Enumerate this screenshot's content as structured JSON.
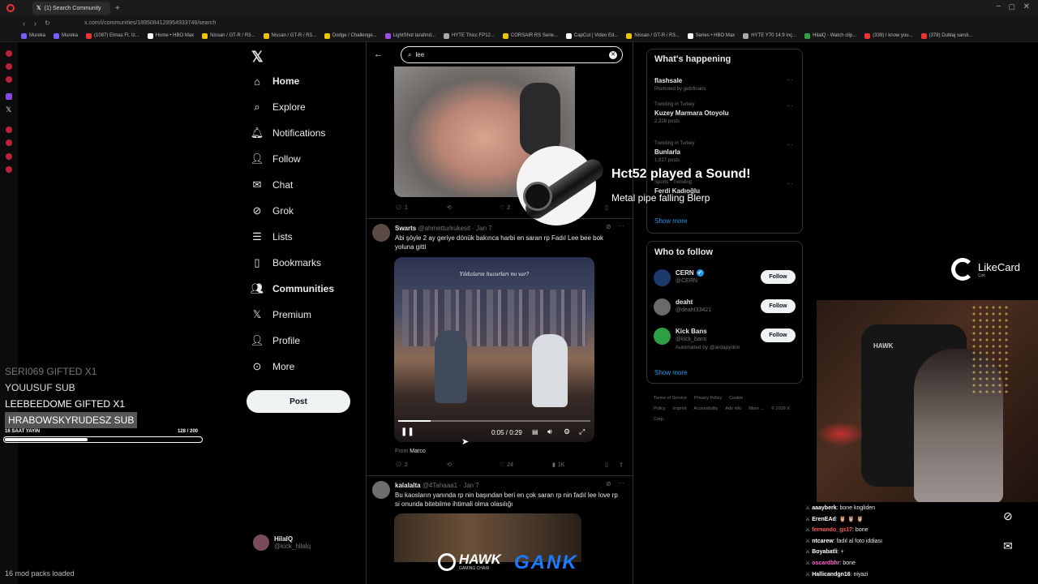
{
  "browser": {
    "tab_title": "(1) Search Community",
    "url": "x.com/i/communities/1895084128954933746/search",
    "bookmarks": [
      "Mureka",
      "Mureka",
      "(1087) Elmas Ft. İz...",
      "Home • HBO Max",
      "Nissan / GT-R / R3...",
      "Nissan / GT-R / R3...",
      "Dodge / Challenge...",
      "LightShot tarafınd...",
      "HYTE Thicc FP12...",
      "CORSAIR RS Serie...",
      "CapCut | Video Ed...",
      "Nissan / GT-R / R3...",
      "Series • HBO Max",
      "HYTE Y70 14.9 inç...",
      "HilalQ - Watch clip...",
      "(339) I know you...",
      "(378) Dublaj sandı..."
    ]
  },
  "nav": {
    "items": [
      {
        "label": "Home",
        "icon": "home-icon",
        "bold": true
      },
      {
        "label": "Explore",
        "icon": "search-icon"
      },
      {
        "label": "Notifications",
        "icon": "bell-icon"
      },
      {
        "label": "Follow",
        "icon": "add-user-icon"
      },
      {
        "label": "Chat",
        "icon": "mail-icon"
      },
      {
        "label": "Grok",
        "icon": "grok-icon"
      },
      {
        "label": "Lists",
        "icon": "list-icon"
      },
      {
        "label": "Bookmarks",
        "icon": "bookmark-icon"
      },
      {
        "label": "Communities",
        "icon": "communities-icon",
        "bold": true
      },
      {
        "label": "Premium",
        "icon": "x-icon"
      },
      {
        "label": "Profile",
        "icon": "person-icon"
      },
      {
        "label": "More",
        "icon": "more-circle-icon"
      }
    ],
    "post_label": "Post",
    "profile_name": "HilalQ",
    "profile_handle": "@kick_hilalq"
  },
  "search": {
    "query": "lee"
  },
  "tweets": [
    {
      "top_actions": {
        "replies": "1",
        "retweets": "",
        "likes": "2"
      }
    },
    {
      "name": "Swarts",
      "handle_time": "@ahmetturkukesit · Jan 7",
      "text": "Abi şöyle 2 ay geriye dönük bakınca harbi en saran rp Fadıl Lee bee bok yoluna gitti",
      "video_caption": "Yıldızların huzurları mı var?",
      "video_time": "0:05 / 0:29",
      "video_progress": 0.17,
      "from_label": "From",
      "from_name": "Marco",
      "replies": "2",
      "retweets": "",
      "likes": "24",
      "views": "1K"
    },
    {
      "name": "kalalalta",
      "handle_time": "@4Tahaaa1 · Jan 7",
      "text": "Bu kaosların yanında rp nin başından beri en çok saran rp nin fadıl lee love rp si onunda bitebilme ihtimali olma olasılığı"
    }
  ],
  "whats_happening": {
    "title": "What's happening",
    "trends": [
      {
        "context": "",
        "name": "flashsale",
        "meta": "Promoted by getirfinans"
      },
      {
        "context": "Trending in Turkey",
        "name": "Kuzey Marmara Otoyolu",
        "meta": "2,328 posts"
      },
      {
        "context": "Trending in Turkey",
        "name": "Bunlarla",
        "meta": "1,917 posts"
      },
      {
        "context": "Sports · Trending",
        "name": "Ferdi Kadıoğlu",
        "meta": ""
      }
    ],
    "show_more": "Show more"
  },
  "who_to_follow": {
    "title": "Who to follow",
    "users": [
      {
        "name": "CERN",
        "handle": "@CERN",
        "verified": true,
        "note": ""
      },
      {
        "name": "deaht",
        "handle": "@deaht33421",
        "verified": false,
        "note": ""
      },
      {
        "name": "Kick Bans",
        "handle": "@kick_bans",
        "verified": false,
        "note": "Automated by @ardapydnn"
      }
    ],
    "follow_label": "Follow",
    "show_more": "Show more"
  },
  "footer_links": [
    "Terms of Service",
    "Privacy Policy",
    "Cookie Policy",
    "Imprint",
    "Accessibility",
    "Ads info",
    "More ...",
    "© 2026 X Corp."
  ],
  "overlay": {
    "sound_title": "Hct52 played a Sound!",
    "sound_name": "Metal pipe falling Blerp",
    "sponsor": "LikeCard",
    "sponsor_sub": "Çok",
    "subs": [
      "SERI069  GIFTED X1",
      "YOUUSUF  SUB",
      "LEEBEEDOME  GIFTED X1",
      "HRABOWSKYRUDESZ  SUB"
    ],
    "progress_label": "16 SAAT YAYIN",
    "progress_value": "128  / 200",
    "progress_fraction": 0.64,
    "bottom_left": "16 mod packs loaded",
    "brand1": "HAWK",
    "brand1_sub": "GAMING CHAIR",
    "brand2": "GANK"
  },
  "chat": [
    {
      "user": "aaayberk",
      "color": "#ffffff",
      "msg": "bone kngliden"
    },
    {
      "user": "ErenEAd",
      "color": "#ffffff",
      "msg": "🦉 🦉 🦉"
    },
    {
      "user": "fernando_gs17",
      "color": "#ff5a5a",
      "msg": "bone"
    },
    {
      "user": "ntcarew",
      "color": "#ffffff",
      "msg": "fadıl al foto iddiası"
    },
    {
      "user": "Boyabatli",
      "color": "#ffffff",
      "msg": "+"
    },
    {
      "user": "oscardbhr",
      "color": "#ff66cc",
      "msg": "bone"
    },
    {
      "user": "Hallicandgn16",
      "color": "#ffffff",
      "msg": "niyazi"
    }
  ],
  "colors": {
    "accent": "#1d9bf0",
    "verified": "#1d9bf0",
    "sponsor": "#ffffff"
  }
}
